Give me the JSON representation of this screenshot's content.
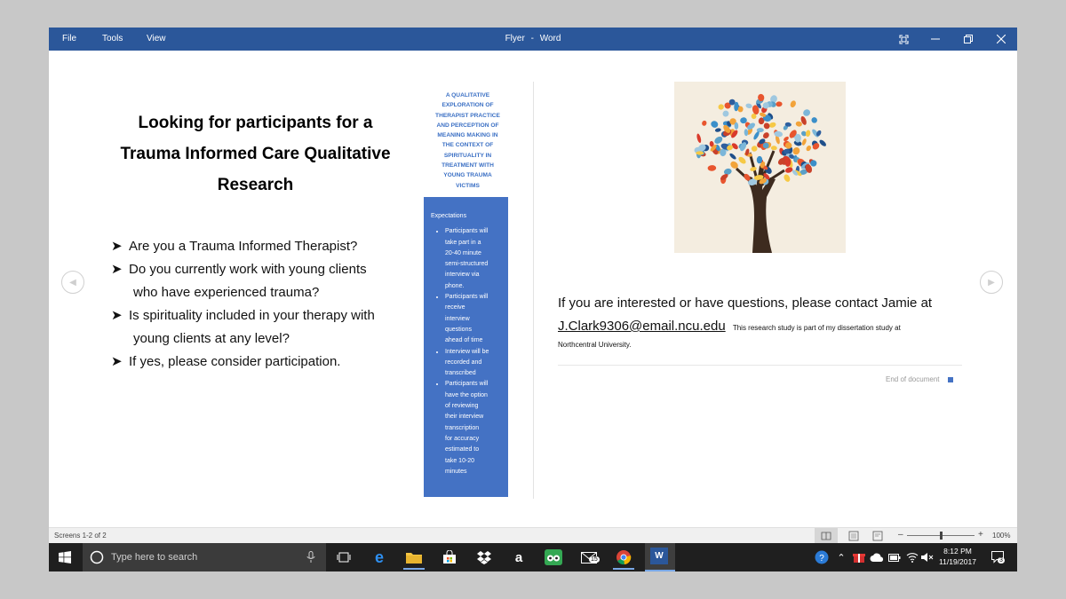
{
  "window": {
    "title": "Flyer",
    "app": "Word",
    "separator": "-"
  },
  "menu": [
    "File",
    "Tools",
    "View"
  ],
  "flyer": {
    "headline_lines": [
      "Looking for participants for a",
      "Trauma Informed Care Qualitative",
      "Research"
    ],
    "bullets": [
      [
        "Are you a Trauma Informed Therapist?"
      ],
      [
        "Do you currently work with young clients",
        "who have experienced trauma?"
      ],
      [
        "Is spirituality included in your therapy with",
        "young clients at any level?"
      ],
      [
        "If yes, please consider participation."
      ]
    ],
    "subtitle_lines": [
      "A QUALITATIVE",
      "EXPLORATION OF",
      "THERAPIST PRACTICE",
      "AND PERCEPTION OF",
      "MEANING MAKING IN",
      "THE CONTEXT OF",
      "SPIRITUALITY IN",
      "TREATMENT WITH",
      "YOUNG TRAUMA",
      "VICTIMS"
    ],
    "expectations_title": "Expectations",
    "expectations": [
      [
        "Participants will",
        "take part in a",
        "20-40 minute",
        "semi-structured",
        "interview via",
        "phone."
      ],
      [
        "Participants will",
        "receive",
        "interview",
        "questions",
        "ahead of time"
      ],
      [
        "Interview will be",
        "recorded and",
        "transcribed"
      ],
      [
        "Participants will",
        "have the option",
        "of reviewing",
        "their interview",
        "transcription",
        "for accuracy",
        "estimated to",
        "take 10-20",
        "minutes"
      ]
    ],
    "contact_text": "If you are interested or have questions, please contact Jamie at",
    "email": "J.Clark9306@email.ncu.edu",
    "dissertation_note": "This research study is part of my dissertation study at",
    "university": "Northcentral University.",
    "end_of_document": "End of document"
  },
  "status": {
    "screens": "Screens 1-2 of 2",
    "zoom": "100%",
    "zoom_level": 1.0
  },
  "taskbar": {
    "search_placeholder": "Type here to search",
    "time": "8:12 PM",
    "date": "11/19/2017",
    "mail_badge": "15",
    "notification_badge": "3",
    "pinned_apps": [
      "task-view",
      "edge",
      "file-explorer",
      "store",
      "dropbox",
      "amazon",
      "tripadvisor",
      "mail",
      "chrome",
      "word"
    ]
  },
  "colors": {
    "titlebar": "#2b579a",
    "accent_blue": "#4472c4",
    "subtitle_blue": "#3a6fc4",
    "taskbar": "#1f1f1f"
  }
}
